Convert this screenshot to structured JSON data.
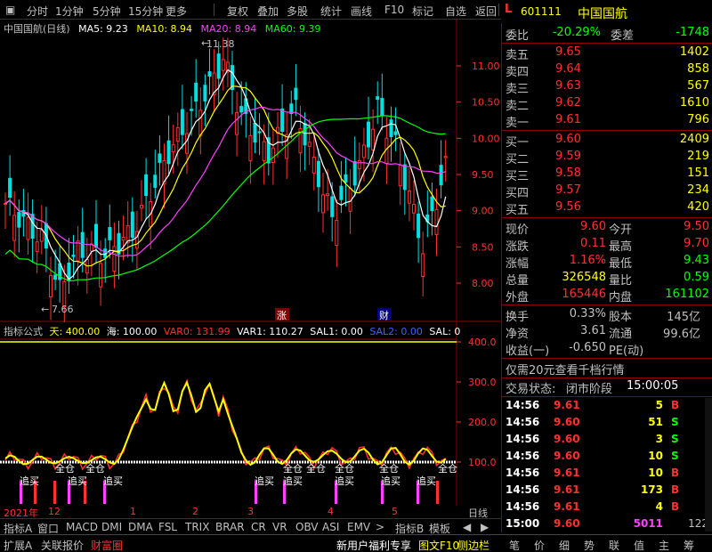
{
  "toolbar": {
    "items": [
      "分时",
      "1分钟",
      "5分钟",
      "15分钟",
      "更多",
      "复权",
      "叠加",
      "多股",
      "统计",
      "画线",
      "F10",
      "标记",
      "自选",
      "返回"
    ]
  },
  "header": {
    "badge": "L",
    "code": "601111",
    "name": "中国国航"
  },
  "main_legend": {
    "title": "中国国航(日线)",
    "ma5": "MA5: 9.23",
    "ma10": "MA10: 8.94",
    "ma20": "MA20: 8.94",
    "ma60": "MA60: 9.39"
  },
  "colors": {
    "up": "#ff3030",
    "down": "#00e0e0",
    "ma5": "#ffffff",
    "ma10": "#ffff00",
    "ma20": "#ff40ff",
    "ma60": "#00ff00",
    "label": "#c0c0c0"
  },
  "chart_annotations": {
    "high": "11.38",
    "low": "7.66",
    "zhang": "涨",
    "cai": "财"
  },
  "price_axis": [
    "11.00",
    "10.50",
    "10.00",
    "9.50",
    "9.00",
    "8.50",
    "8.00"
  ],
  "ind_legend": {
    "name": "指标公式",
    "tian": "天: 400.00",
    "hai": "海: 100.00",
    "var0": "VAR0: 131.99",
    "var1": "VAR1: 110.27",
    "sal1": "SAL1: 0.00",
    "sal2": "SAL2: 0.00",
    "sal": "SAL: 0"
  },
  "ind_axis": [
    "400.0",
    "300.0",
    "200.0",
    "100.0"
  ],
  "ind_signals": {
    "buy": "追买",
    "full": "全仓"
  },
  "time_axis": [
    "2021年",
    "12",
    "1",
    "2",
    "3",
    "4",
    "5"
  ],
  "period": "日线",
  "bottom_tabs": [
    "指标A",
    "窗口",
    "MACD",
    "DMI",
    "DMA",
    "FSL",
    "TRIX",
    "BRAR",
    "CR",
    "VR",
    "OBV",
    "ASI",
    "EMV",
    ">",
    "指标B",
    "模板"
  ],
  "weibi": {
    "label": "委比",
    "value": "-20.29%",
    "label2": "委差",
    "value2": "-1748"
  },
  "sell": [
    {
      "label": "卖五",
      "price": "9.65",
      "vol": "1402"
    },
    {
      "label": "卖四",
      "price": "9.64",
      "vol": "858"
    },
    {
      "label": "卖三",
      "price": "9.63",
      "vol": "567"
    },
    {
      "label": "卖二",
      "price": "9.62",
      "vol": "1610"
    },
    {
      "label": "卖一",
      "price": "9.61",
      "vol": "796"
    }
  ],
  "buy": [
    {
      "label": "买一",
      "price": "9.60",
      "vol": "2409"
    },
    {
      "label": "买二",
      "price": "9.59",
      "vol": "219"
    },
    {
      "label": "买三",
      "price": "9.58",
      "vol": "151"
    },
    {
      "label": "买四",
      "price": "9.57",
      "vol": "234"
    },
    {
      "label": "买五",
      "price": "9.56",
      "vol": "420"
    }
  ],
  "stats": [
    {
      "l1": "现价",
      "v1": "9.60",
      "c1": "#ff3030",
      "l2": "今开",
      "v2": "9.50",
      "c2": "#ff3030"
    },
    {
      "l1": "涨跌",
      "v1": "0.11",
      "c1": "#ff3030",
      "l2": "最高",
      "v2": "9.70",
      "c2": "#ff3030"
    },
    {
      "l1": "涨幅",
      "v1": "1.16%",
      "c1": "#ff3030",
      "l2": "最低",
      "v2": "9.43",
      "c2": "#00ff00"
    },
    {
      "l1": "总量",
      "v1": "326548",
      "c1": "#ffff00",
      "l2": "量比",
      "v2": "0.59",
      "c2": "#00ff00"
    },
    {
      "l1": "外盘",
      "v1": "165446",
      "c1": "#ff3030",
      "l2": "内盘",
      "v2": "161102",
      "c2": "#00ff00"
    }
  ],
  "stats2": [
    {
      "l1": "换手",
      "v1": "0.33%",
      "l2": "股本",
      "v2": "145亿"
    },
    {
      "l1": "净资",
      "v1": "3.61",
      "l2": "流通",
      "v2": "99.6亿"
    },
    {
      "l1": "收益(一)",
      "v1": "-0.650",
      "l2": "PE(动)",
      "v2": ""
    }
  ],
  "promo": "仅需20元查看千档行情",
  "trade_status": {
    "label": "交易状态:",
    "value": "闭市阶段",
    "time": "15:00:05"
  },
  "ticks": [
    {
      "time": "14:56",
      "price": "9.61",
      "pc": "#ff3030",
      "vol": "5",
      "vc": "#ffff00",
      "side": "B",
      "sc": "#ff3030"
    },
    {
      "time": "14:56",
      "price": "9.60",
      "pc": "#ff3030",
      "vol": "51",
      "vc": "#ffff00",
      "side": "S",
      "sc": "#00ff00"
    },
    {
      "time": "14:56",
      "price": "9.60",
      "pc": "#ff3030",
      "vol": "3",
      "vc": "#ffff00",
      "side": "S",
      "sc": "#00ff00"
    },
    {
      "time": "14:56",
      "price": "9.60",
      "pc": "#ff3030",
      "vol": "10",
      "vc": "#ffff00",
      "side": "S",
      "sc": "#00ff00"
    },
    {
      "time": "14:56",
      "price": "9.61",
      "pc": "#ff3030",
      "vol": "10",
      "vc": "#ffff00",
      "side": "B",
      "sc": "#ff3030"
    },
    {
      "time": "14:56",
      "price": "9.61",
      "pc": "#ff3030",
      "vol": "173",
      "vc": "#ffff00",
      "side": "B",
      "sc": "#ff3030"
    },
    {
      "time": "14:56",
      "price": "9.61",
      "pc": "#ff3030",
      "vol": "4",
      "vc": "#ffff00",
      "side": "B",
      "sc": "#ff3030"
    },
    {
      "time": "15:00",
      "price": "9.60",
      "pc": "#ff3030",
      "vol": "5011",
      "vc": "#ff40ff",
      "side": "",
      "sc": "#ff3030"
    }
  ],
  "tick_extra": "122",
  "status_left": [
    "扩展A",
    "关联报价",
    "财富圈"
  ],
  "status_promo": "新用户福利专享",
  "status_mid": [
    "图文F10",
    "侧边栏"
  ],
  "bottom_buttons": [
    "笔",
    "价",
    "细",
    "势",
    "联",
    "值",
    "主",
    "筹"
  ]
}
